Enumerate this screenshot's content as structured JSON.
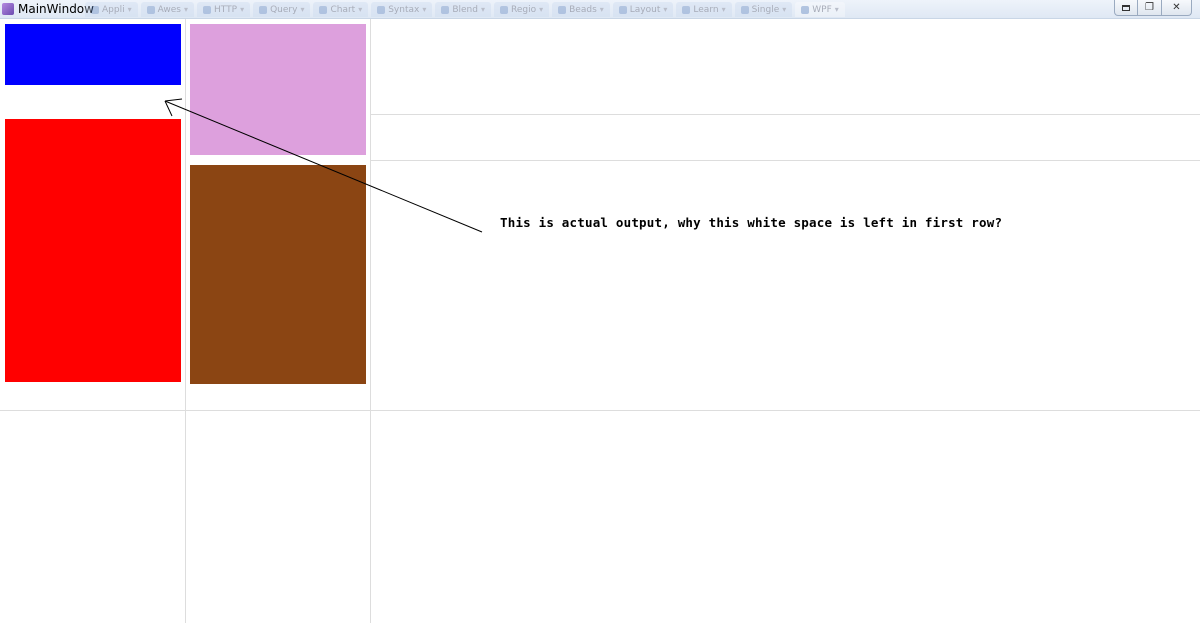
{
  "window": {
    "title": "MainWindow",
    "background_tabs": [
      {
        "label": "Appli",
        "icon": "app-tab-icon"
      },
      {
        "label": "Awes",
        "icon": "app-tab-icon"
      },
      {
        "label": "HTTP",
        "icon": "app-tab-icon"
      },
      {
        "label": "Query",
        "icon": "app-tab-icon"
      },
      {
        "label": "Chart",
        "icon": "app-tab-icon"
      },
      {
        "label": "Syntax",
        "icon": "app-tab-icon"
      },
      {
        "label": "Blend",
        "icon": "app-tab-icon"
      },
      {
        "label": "Regio",
        "icon": "app-tab-icon"
      },
      {
        "label": "Beads",
        "icon": "app-tab-icon"
      },
      {
        "label": "Layout",
        "icon": "app-tab-icon"
      },
      {
        "label": "Learn",
        "icon": "app-tab-icon"
      },
      {
        "label": "Single",
        "icon": "app-tab-icon"
      },
      {
        "label": "WPF",
        "icon": "app-tab-icon"
      }
    ],
    "controls": {
      "minimize": "minimize-icon",
      "restore": "restore-icon",
      "close": "close-icon",
      "restore_glyph": "❐",
      "close_glyph": "✕"
    }
  },
  "rectangles": [
    {
      "name": "blue-rectangle",
      "color": "#0000ff"
    },
    {
      "name": "plum-rectangle",
      "color": "#dda0dd"
    },
    {
      "name": "red-rectangle",
      "color": "#ff0000"
    },
    {
      "name": "brown-rectangle",
      "color": "#8b4513"
    }
  ],
  "annotation": {
    "text": "This is actual output, why this white space is left in first row?"
  }
}
